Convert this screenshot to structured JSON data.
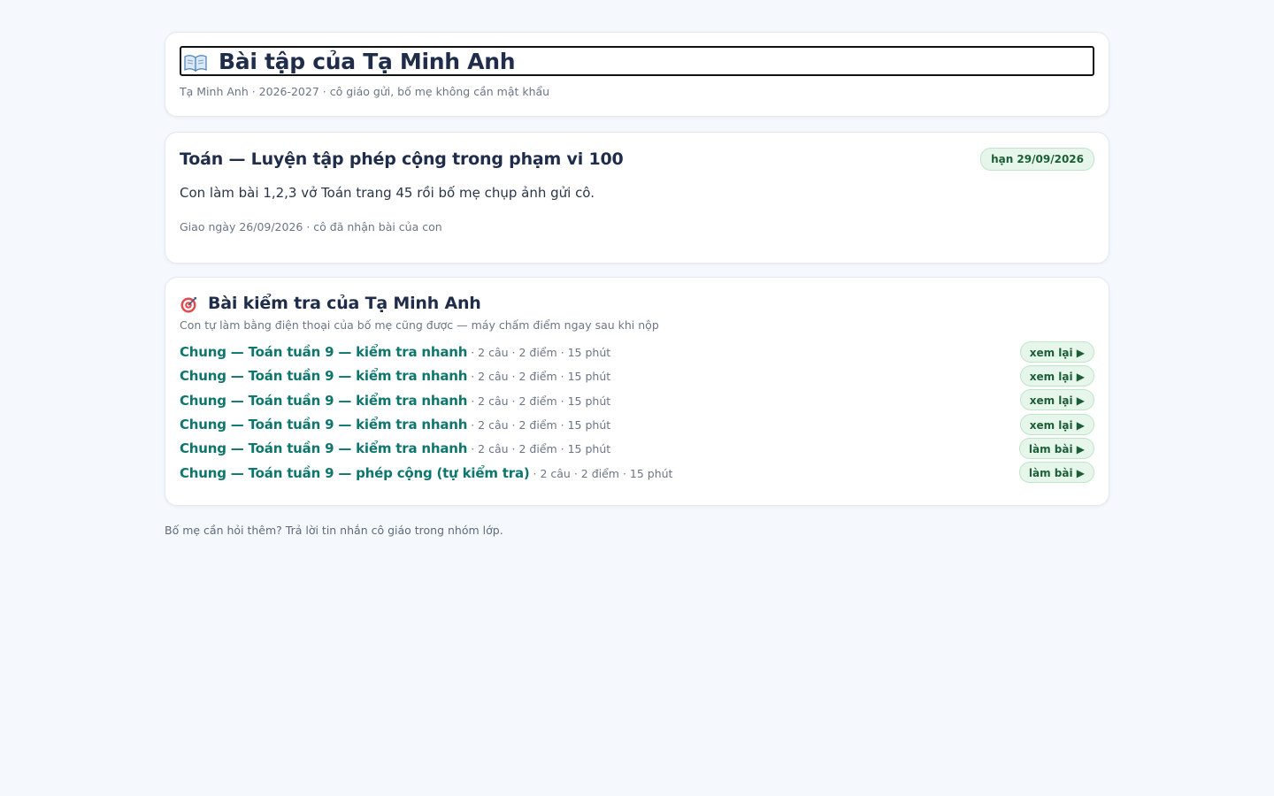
{
  "header": {
    "title": "Bài tập của Tạ Minh Anh",
    "icon": "open-book-icon",
    "meta": "Tạ Minh Anh · 2026-2027 · cô giáo gửi, bố mẹ không cần mật khẩu"
  },
  "assignment": {
    "title": "Toán — Luyện tập phép cộng trong phạm vi 100",
    "due": "hạn 29/09/2026",
    "body": "Con làm bài 1,2,3 vở Toán trang 45 rồi bố mẹ chụp ảnh gửi cô.",
    "meta": "Giao ngày 26/09/2026 · cô đã nhận bài của con"
  },
  "quizzes": {
    "icon": "target-icon",
    "title": "Bài kiểm tra của Tạ Minh Anh",
    "subtitle": "Con tự làm bằng điện thoại của bố mẹ cũng được — máy chấm điểm ngay sau khi nộp",
    "items": [
      {
        "name": "Chung — Toán tuần 9 — kiểm tra nhanh",
        "info": " · 2 câu · 2 điểm · 15 phút",
        "action": "xem lại ▶"
      },
      {
        "name": "Chung — Toán tuần 9 — kiểm tra nhanh",
        "info": " · 2 câu · 2 điểm · 15 phút",
        "action": "xem lại ▶"
      },
      {
        "name": "Chung — Toán tuần 9 — kiểm tra nhanh",
        "info": " · 2 câu · 2 điểm · 15 phút",
        "action": "xem lại ▶"
      },
      {
        "name": "Chung — Toán tuần 9 — kiểm tra nhanh",
        "info": " · 2 câu · 2 điểm · 15 phút",
        "action": "xem lại ▶"
      },
      {
        "name": "Chung — Toán tuần 9 — kiểm tra nhanh",
        "info": " · 2 câu · 2 điểm · 15 phút",
        "action": "làm bài ▶"
      },
      {
        "name": "Chung — Toán tuần 9 — phép cộng (tự kiểm tra)",
        "info": " · 2 câu · 2 điểm · 15 phút",
        "action": "làm bài ▶"
      }
    ]
  },
  "footer": {
    "note": "Bố mẹ cần hỏi thêm? Trả lời tin nhắn cô giáo trong nhóm lớp."
  },
  "colors": {
    "background": "#f5f8fc",
    "accent_link": "#0f766e",
    "badge_bg": "#e6f6ea",
    "badge_text": "#1b5e37",
    "title_text": "#1f2d4a"
  }
}
